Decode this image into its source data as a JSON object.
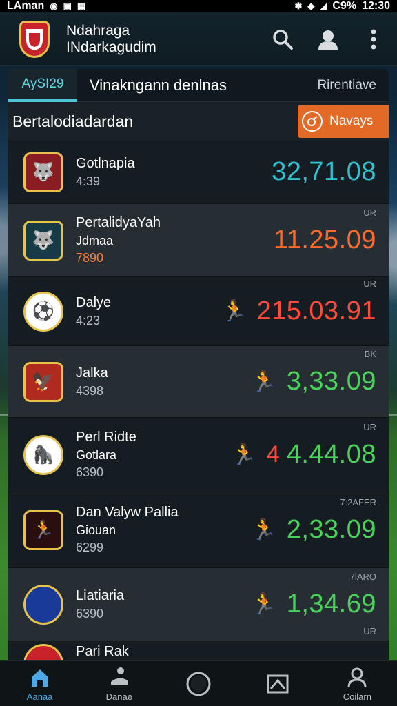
{
  "status_bar": {
    "carrier": "LAman",
    "battery": "C9%",
    "time": "12:30"
  },
  "header": {
    "title_line1": "Ndahraga",
    "title_line2": "INdarkagudim",
    "icons": [
      "search-icon",
      "profile-icon",
      "more-vert-icon"
    ]
  },
  "tabs": {
    "active": "AySI29",
    "main": "Vinakngann denlnas",
    "right": "Rirentiave"
  },
  "subheader": {
    "title": "Bertalodiadardan",
    "button_label": "Navays"
  },
  "rows": [
    {
      "name": "Gotlnapia",
      "sub": "",
      "meta": "4:39",
      "meta_color": "grey",
      "tag": "",
      "figure": "",
      "extra": "",
      "value": "32,71.08",
      "value_color": "#2fc3d1",
      "bg": "dark",
      "crest_bg": "#8a1c24",
      "crest_shape": "shield",
      "crest_icon": "🐺"
    },
    {
      "name": "PertalidyaYah",
      "sub": "Jdmaa",
      "meta": "7890",
      "meta_color": "orange",
      "tag": "UR",
      "figure": "",
      "extra": "",
      "value": "11.25.09",
      "value_color": "#ff6a2a",
      "bg": "light",
      "crest_bg": "#163a46",
      "crest_shape": "shield",
      "crest_icon": "🐺"
    },
    {
      "name": "Dalye",
      "sub": "",
      "meta": "4:23",
      "meta_color": "grey",
      "tag": "UR",
      "figure": "🏃",
      "figure_color": "#ff4a3a",
      "extra": "",
      "value": "215.03.91",
      "value_color": "#ff4a3a",
      "bg": "dark",
      "crest_bg": "#ffffff",
      "crest_shape": "circle",
      "crest_icon": "⚽"
    },
    {
      "name": "Jalka",
      "sub": "",
      "meta": "4398",
      "meta_color": "grey",
      "tag": "BK",
      "figure": "🏃",
      "figure_color": "#49d35a",
      "extra": "",
      "value": "3,33.09",
      "value_color": "#49d35a",
      "bg": "light",
      "crest_bg": "#b02a20",
      "crest_shape": "shield",
      "crest_icon": "🦅"
    },
    {
      "name": "Perl Ridte",
      "sub": "Gotlara",
      "meta": "6390",
      "meta_color": "grey",
      "tag": "UR",
      "figure": "🏃",
      "figure_color": "#ff4a7a",
      "extra": "4",
      "value": "4.44.08",
      "value_color": "#49d35a",
      "bg": "dark",
      "crest_bg": "#ffffff",
      "crest_shape": "circle",
      "crest_icon": "🦍"
    },
    {
      "name": "Dan Valyw Pallia",
      "sub": "Giouan",
      "meta": "6299",
      "meta_color": "grey",
      "tag": "7:2AFER",
      "figure": "🏃",
      "figure_color": "#f0c030",
      "extra": "",
      "value": "2,33.09",
      "value_color": "#49d35a",
      "bg": "dark",
      "crest_bg": "#2a0f10",
      "crest_shape": "shield",
      "crest_icon": "🏃"
    },
    {
      "name": "Liatiaria",
      "sub": "",
      "meta": "6390",
      "meta_color": "grey",
      "tag": "7lARO",
      "figure": "🏃",
      "figure_color": "#49d35a",
      "extra": "",
      "value": "1,34.69",
      "value_color": "#49d35a",
      "bg": "light",
      "crest_bg": "#1a3a9a",
      "crest_shape": "circle",
      "crest_icon": ""
    },
    {
      "name": "Pari Rak",
      "sub": "",
      "meta": "",
      "meta_color": "grey",
      "tag": "UR",
      "figure": "",
      "extra": "",
      "value": "",
      "value_color": "#49d35a",
      "bg": "dark",
      "crest_bg": "#c8222a",
      "crest_shape": "circle",
      "crest_icon": ""
    }
  ],
  "bottom_nav": [
    {
      "label": "Aanaa",
      "icon": "home-icon",
      "active": true
    },
    {
      "label": "Danae",
      "icon": "soccer-player-icon",
      "active": false
    },
    {
      "label": "",
      "icon": "circle-icon",
      "active": false
    },
    {
      "label": "",
      "icon": "mail-icon",
      "active": false
    },
    {
      "label": "Coilarn",
      "icon": "profile-icon",
      "active": false
    }
  ]
}
